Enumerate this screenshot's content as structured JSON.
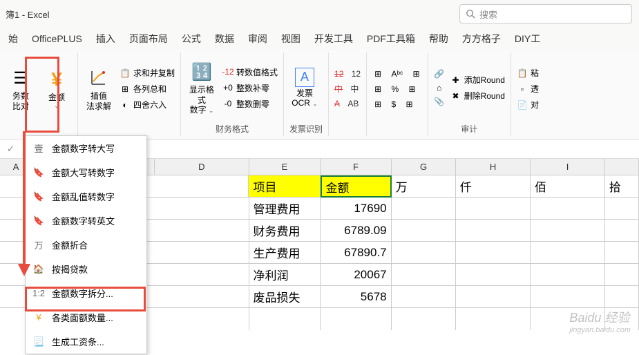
{
  "title": "簿1 - Excel",
  "search_placeholder": "搜索",
  "tabs": [
    "始",
    "OfficePLUS",
    "插入",
    "页面布局",
    "公式",
    "数据",
    "审阅",
    "视图",
    "开发工具",
    "PDF工具箱",
    "帮助",
    "方方格子",
    "DIY工"
  ],
  "ribbon": {
    "group1": {
      "btn1_line1": "务数",
      "btn1_line2": "比对",
      "amount_label": "金额"
    },
    "group2": {
      "btn_line1": "插值",
      "btn_line2": "法求解",
      "sum_copy": "求和并复制",
      "col_sum": "各列总和",
      "round": "四舍六入"
    },
    "group3": {
      "label": "财务格式",
      "display_fmt": "显示格式",
      "display_fmt2": "数字",
      "fmt1": "转数值格式",
      "fmt2": "整数补零",
      "fmt3": "整数删零"
    },
    "group4": {
      "label": "发票识别",
      "invoice1": "发票",
      "invoice2": "OCR"
    },
    "group5": {
      "s12a": "12",
      "s12b": "12",
      "s_cn_a": "中",
      "s_cn_b": "中",
      "s_a_a": "A",
      "s_ab_b": "AB"
    },
    "group6": {
      "b1": "Aᵇᶜ",
      "b2": "%",
      "b3": "$"
    },
    "group7": {
      "label": "审计",
      "add_round": "添加Round",
      "del_round": "删除Round"
    },
    "group8": {
      "b1": "粘",
      "b2": "透",
      "b3": "对"
    }
  },
  "menu": {
    "items": [
      {
        "icon": "壹",
        "label": "金额数字转大写"
      },
      {
        "icon": "bookmark",
        "label": "金额大写转数字"
      },
      {
        "icon": "bookmark",
        "label": "金额乱值转数字"
      },
      {
        "icon": "bookmark",
        "label": "金额数字转英文"
      },
      {
        "icon": "万",
        "label": "金额折合"
      },
      {
        "icon": "house",
        "label": "按揭贷款"
      },
      {
        "icon": "1:2",
        "label": "金额数字拆分..."
      },
      {
        "icon": "yen",
        "label": "各类面额数量..."
      },
      {
        "icon": "sheet",
        "label": "生成工资条..."
      }
    ]
  },
  "columns": {
    "A": "A",
    "D": "D",
    "E": "E",
    "F": "F",
    "G": "G",
    "H": "H",
    "I": "I"
  },
  "chart_data": {
    "type": "table",
    "headers": [
      "项目",
      "金额",
      "万",
      "仟",
      "佰",
      "拾"
    ],
    "rows": [
      {
        "name": "管理费用",
        "value": 17690
      },
      {
        "name": "财务费用",
        "value": 6789.09
      },
      {
        "name": "生产费用",
        "value": 67890.7
      },
      {
        "name": "净利润",
        "value": 20067
      },
      {
        "name": "废品损失",
        "value": 5678
      }
    ]
  },
  "watermark": {
    "main": "Baidu 经验",
    "sub": "jingyan.baidu.com"
  }
}
